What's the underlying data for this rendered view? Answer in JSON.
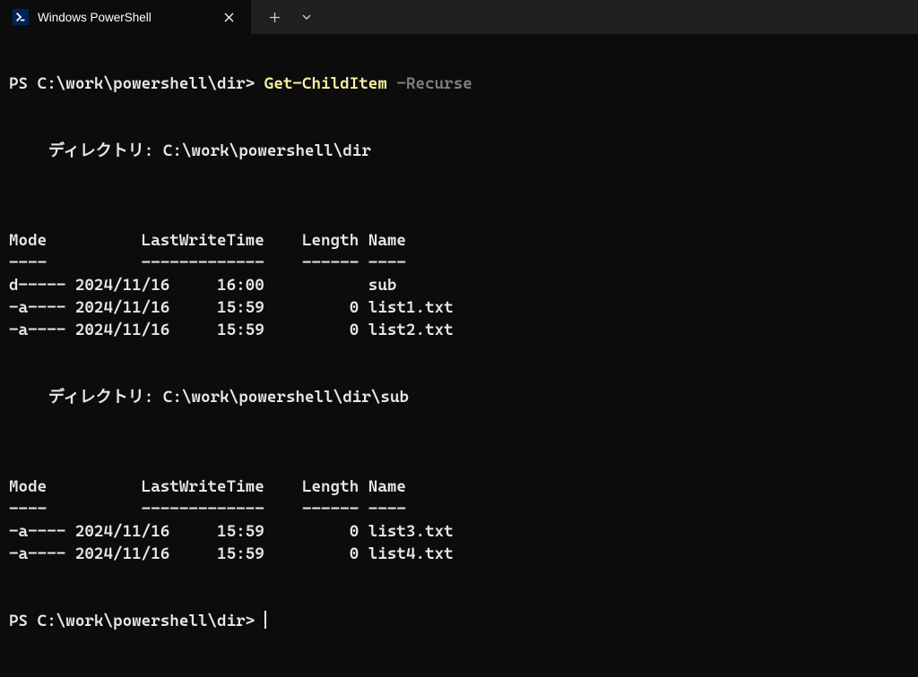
{
  "tab": {
    "title": "Windows PowerShell"
  },
  "prompt": {
    "ps": "PS C:\\work\\powershell\\dir>",
    "cmd": "Get-ChildItem",
    "param": "-Recurse"
  },
  "dirLabel": "ディレクトリ:",
  "headers": {
    "mode": "Mode",
    "lwt": "LastWriteTime",
    "len": "Length",
    "name": "Name",
    "modeU": "----",
    "lwtU": "-------------",
    "lenU": "------",
    "nameU": "----"
  },
  "listings": [
    {
      "path": "C:\\work\\powershell\\dir",
      "rows": [
        {
          "mode": "d-----",
          "date": "2024/11/16",
          "time": "16:00",
          "length": "",
          "name": "sub"
        },
        {
          "mode": "-a----",
          "date": "2024/11/16",
          "time": "15:59",
          "length": "0",
          "name": "list1.txt"
        },
        {
          "mode": "-a----",
          "date": "2024/11/16",
          "time": "15:59",
          "length": "0",
          "name": "list2.txt"
        }
      ]
    },
    {
      "path": "C:\\work\\powershell\\dir\\sub",
      "rows": [
        {
          "mode": "-a----",
          "date": "2024/11/16",
          "time": "15:59",
          "length": "0",
          "name": "list3.txt"
        },
        {
          "mode": "-a----",
          "date": "2024/11/16",
          "time": "15:59",
          "length": "0",
          "name": "list4.txt"
        }
      ]
    }
  ]
}
